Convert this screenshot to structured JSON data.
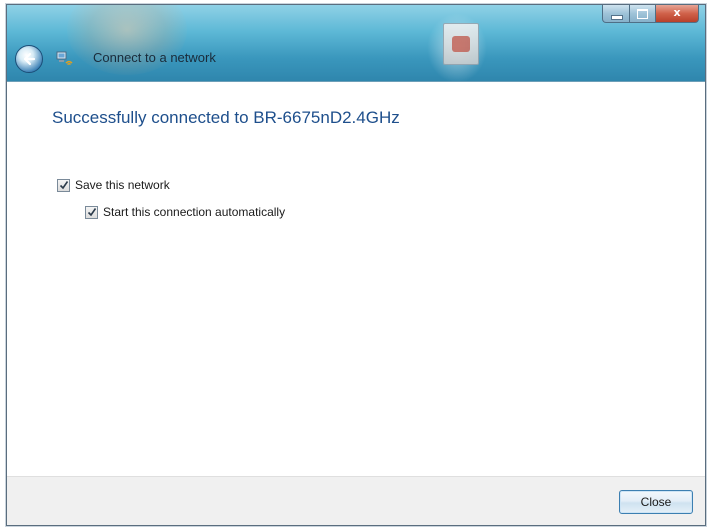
{
  "window": {
    "title": "Connect to a network",
    "controls": {
      "minimize_icon": "minimize-icon",
      "maximize_icon": "maximize-icon",
      "close_glyph": "x"
    }
  },
  "content": {
    "heading": "Successfully connected to BR-6675nD2.4GHz",
    "options": [
      {
        "label": "Save this network",
        "checked": true
      },
      {
        "label": "Start this connection automatically",
        "checked": true
      }
    ]
  },
  "footer": {
    "close_label": "Close"
  },
  "colors": {
    "heading": "#1e4f8c",
    "titlebar": "#3a97bd",
    "footer": "#f0f0f0"
  }
}
